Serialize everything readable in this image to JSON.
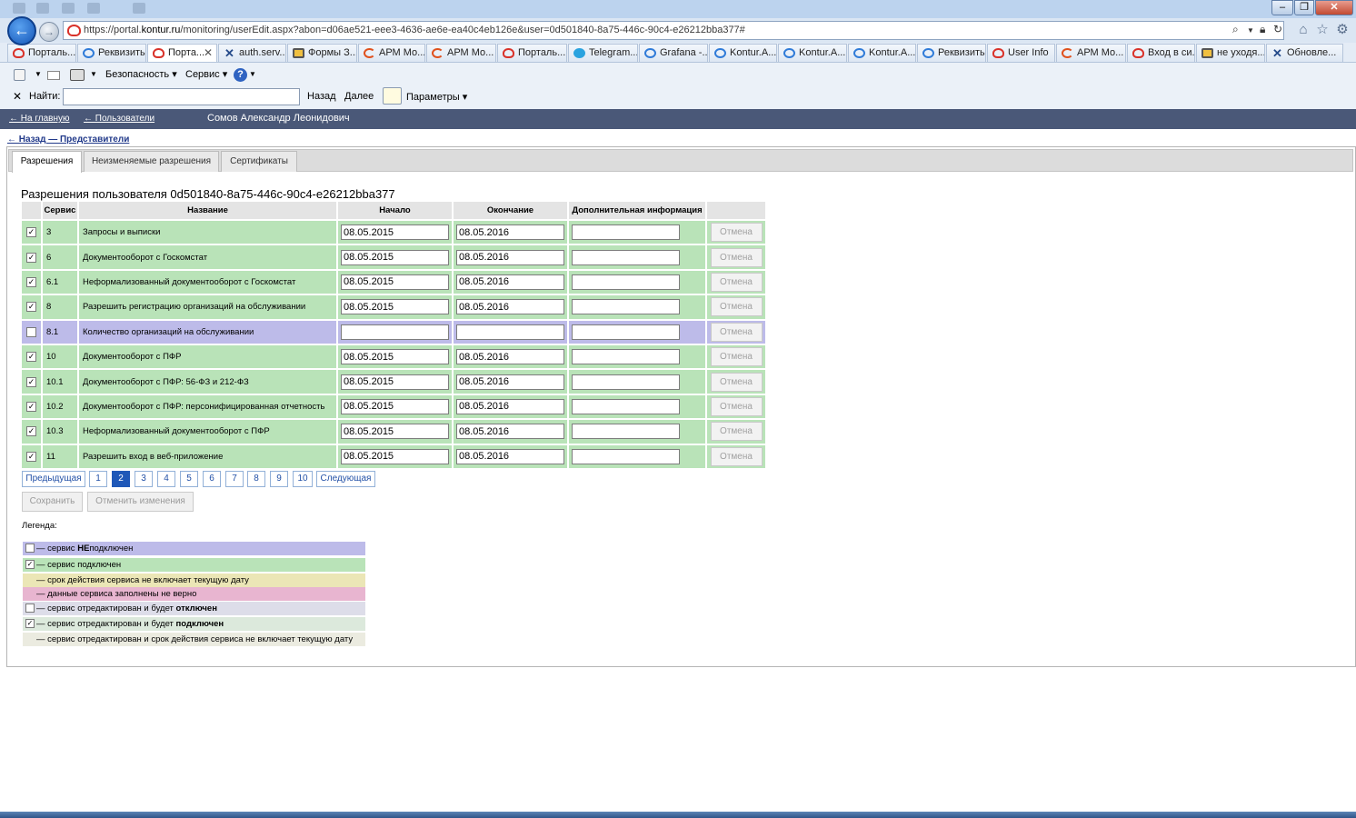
{
  "browser": {
    "url_prefix": "https://portal.",
    "url_host": "kontur.ru",
    "url_rest": "/monitoring/userEdit.aspx?abon=d06ae521-eee3-4636-ae6e-ea40c4eb126e&user=0d501840-8a75-446c-90c4-e26212bba377#",
    "tabs": [
      {
        "label": "Порталь...",
        "icon": "kontur-cloud-icon"
      },
      {
        "label": "Реквизиты",
        "icon": "ie-page-icon"
      },
      {
        "label": "Порта...",
        "icon": "kontur-cloud-icon",
        "active": true
      },
      {
        "label": "auth.serv...",
        "icon": "tools-icon"
      },
      {
        "label": "Формы З...",
        "icon": "form-icon"
      },
      {
        "label": "АРМ Мо...",
        "icon": "arm-icon"
      },
      {
        "label": "АРМ Мо...",
        "icon": "arm-icon"
      },
      {
        "label": "Порталь...",
        "icon": "kontur-cloud-icon"
      },
      {
        "label": "Telegram...",
        "icon": "telegram-icon"
      },
      {
        "label": "Grafana -...",
        "icon": "ie-page-icon"
      },
      {
        "label": "Kontur.A...",
        "icon": "ie-page-icon"
      },
      {
        "label": "Kontur.A...",
        "icon": "ie-page-icon"
      },
      {
        "label": "Kontur.A...",
        "icon": "ie-page-icon"
      },
      {
        "label": "Реквизиты",
        "icon": "ie-page-icon"
      },
      {
        "label": "User Info",
        "icon": "kontur-cloud-icon"
      },
      {
        "label": "АРМ Мо...",
        "icon": "arm-icon"
      },
      {
        "label": "Вход в си...",
        "icon": "kontur-cloud-icon"
      },
      {
        "label": "не уходя...",
        "icon": "form-icon"
      },
      {
        "label": "Обновле...",
        "icon": "tools-icon"
      }
    ],
    "menu": {
      "security": "Безопасность",
      "service": "Сервис"
    },
    "find": {
      "label": "Найти:",
      "back": "Назад",
      "next": "Далее",
      "params": "Параметры",
      "value": ""
    }
  },
  "header": {
    "home_link": "← На главную",
    "users_link": "← Пользователи",
    "user_name": "Сомов Александр Леонидович",
    "back_link": "← Назад — Представители"
  },
  "page_tabs": [
    "Разрешения",
    "Неизменяемые разрешения",
    "Сертификаты"
  ],
  "title": "Разрешения пользователя 0d501840-8a75-446c-90c4-e26212bba377",
  "table": {
    "headers": [
      "",
      "Сервис",
      "Название",
      "Начало",
      "Окончание",
      "Дополнительная информация",
      ""
    ],
    "cancel_label": "Отмена",
    "rows": [
      {
        "checked": true,
        "service": "3",
        "name": "Запросы и выписки",
        "start": "08.05.2015",
        "end": "08.05.2016",
        "info": ""
      },
      {
        "checked": true,
        "service": "6",
        "name": "Документооборот с Госкомстат",
        "start": "08.05.2015",
        "end": "08.05.2016",
        "info": ""
      },
      {
        "checked": true,
        "service": "6.1",
        "name": "Неформализованный документооборот с Госкомстат",
        "start": "08.05.2015",
        "end": "08.05.2016",
        "info": ""
      },
      {
        "checked": true,
        "service": "8",
        "name": "Разрешить регистрацию организаций на обслуживании",
        "start": "08.05.2015",
        "end": "08.05.2016",
        "info": ""
      },
      {
        "checked": false,
        "service": "8.1",
        "name": "Количество организаций на обслуживании",
        "start": "",
        "end": "",
        "info": ""
      },
      {
        "checked": true,
        "service": "10",
        "name": "Документооборот с ПФР",
        "start": "08.05.2015",
        "end": "08.05.2016",
        "info": ""
      },
      {
        "checked": true,
        "service": "10.1",
        "name": "Документооборот с ПФР: 56-ФЗ и 212-ФЗ",
        "start": "08.05.2015",
        "end": "08.05.2016",
        "info": ""
      },
      {
        "checked": true,
        "service": "10.2",
        "name": "Документооборот с ПФР: персонифицированная отчетность",
        "start": "08.05.2015",
        "end": "08.05.2016",
        "info": ""
      },
      {
        "checked": true,
        "service": "10.3",
        "name": "Неформализованный документооборот с ПФР",
        "start": "08.05.2015",
        "end": "08.05.2016",
        "info": ""
      },
      {
        "checked": true,
        "service": "11",
        "name": "Разрешить вход в веб-приложение",
        "start": "08.05.2015",
        "end": "08.05.2016",
        "info": ""
      }
    ]
  },
  "pagination": {
    "prev": "Предыдущая",
    "next": "Следующая",
    "pages": [
      "1",
      "2",
      "3",
      "4",
      "5",
      "6",
      "7",
      "8",
      "9",
      "10"
    ],
    "current": "2"
  },
  "actions": {
    "save": "Сохранить",
    "undo": "Отменить изменения"
  },
  "legend": {
    "label": "Легенда:",
    "items": [
      {
        "check": "unchecked",
        "pre": "— сервис ",
        "bold": "НЕ",
        "post": "подключен",
        "color": "#bdbbe9"
      },
      {
        "check": "checked",
        "pre": "— сервис подключен",
        "bold": "",
        "post": "",
        "color": "#b9e3b8"
      },
      {
        "check": "none",
        "pre": "— срок действия сервиса не включает текущую дату",
        "bold": "",
        "post": "",
        "color": "#ebe6b6"
      },
      {
        "check": "none",
        "pre": "— данные сервиса заполнены не верно",
        "bold": "",
        "post": "",
        "color": "#e8b5d0"
      },
      {
        "check": "unchecked",
        "pre": "— сервис отредактирован и будет ",
        "bold": "отключен",
        "post": "",
        "color": "#dddde9"
      },
      {
        "check": "checked",
        "pre": "— сервис отредактирован и будет ",
        "bold": "подключен",
        "post": "",
        "color": "#dce9dc"
      },
      {
        "check": "none",
        "pre": "— сервис отредактирован и срок действия сервиса не включает текущую дату",
        "bold": "",
        "post": "",
        "color": "#ebebe0"
      }
    ]
  },
  "colors": {
    "header_bg": "#4a5878",
    "row_enabled": "#b9e3b8",
    "row_disabled": "#bdbbe9",
    "page_current": "#1f58b8"
  }
}
